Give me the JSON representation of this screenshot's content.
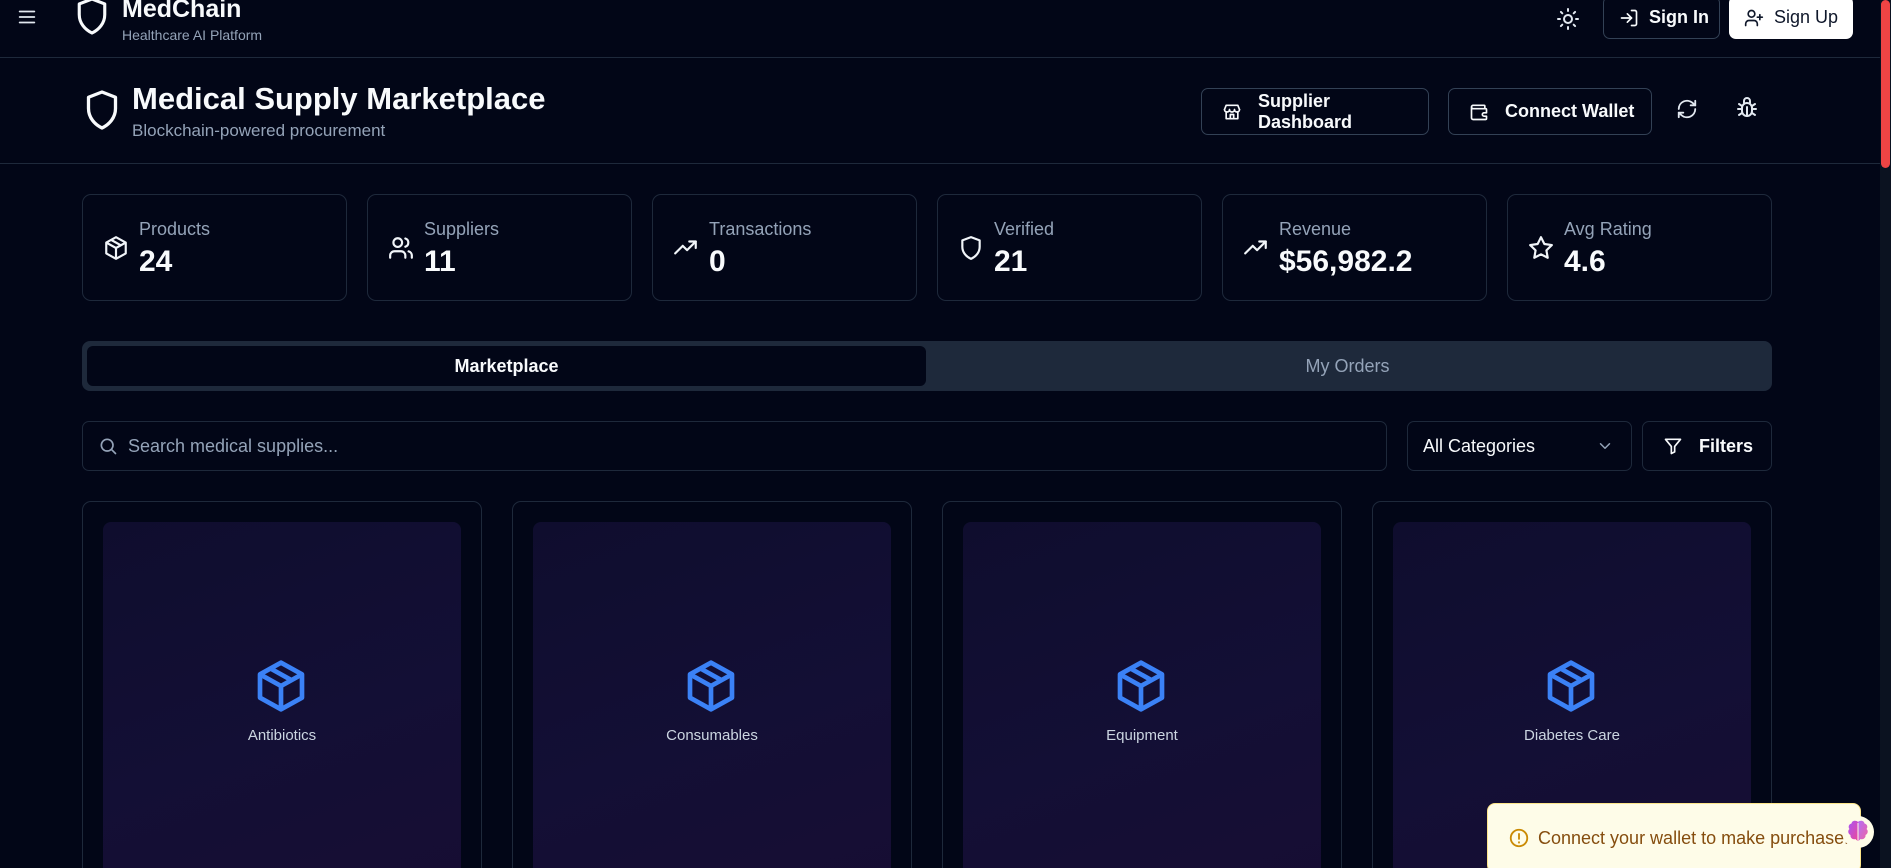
{
  "topbar": {
    "brand_name": "MedChain",
    "brand_subtitle": "Healthcare AI Platform",
    "signin_label": "Sign In",
    "signup_label": "Sign Up",
    "icons": [
      "menu-icon",
      "shield-icon",
      "sun-icon",
      "log-in-icon",
      "user-plus-icon"
    ]
  },
  "page": {
    "title": "Medical Supply Marketplace",
    "subtitle": "Blockchain-powered procurement",
    "supplier_dashboard_label": "Supplier Dashboard",
    "connect_wallet_label": "Connect Wallet",
    "icons": [
      "store-icon",
      "wallet-icon",
      "refresh-icon",
      "bug-icon"
    ]
  },
  "stats": [
    {
      "label": "Products",
      "value": "24",
      "icon": "package-icon"
    },
    {
      "label": "Suppliers",
      "value": "11",
      "icon": "users-icon"
    },
    {
      "label": "Transactions",
      "value": "0",
      "icon": "trending-up-icon"
    },
    {
      "label": "Verified",
      "value": "21",
      "icon": "shield-icon"
    },
    {
      "label": "Revenue",
      "value": "$56,982.2",
      "icon": "trending-up-icon"
    },
    {
      "label": "Avg Rating",
      "value": "4.6",
      "icon": "star-icon"
    }
  ],
  "tabs": [
    {
      "label": "Marketplace",
      "active": true
    },
    {
      "label": "My Orders",
      "active": false
    }
  ],
  "search": {
    "placeholder": "Search medical supplies..."
  },
  "category_select": {
    "value": "All Categories"
  },
  "filters_label": "Filters",
  "products": [
    {
      "category": "Antibiotics"
    },
    {
      "category": "Consumables"
    },
    {
      "category": "Equipment"
    },
    {
      "category": "Diabetes Care"
    }
  ],
  "toast": {
    "message": "Connect your wallet to make purchase."
  },
  "colors": {
    "background": "#020617",
    "border": "#1e293b",
    "accent_blue": "#3b82f6",
    "toast_bg": "#fefce8",
    "toast_text": "#854d0e",
    "scrollbar": "#ef4444"
  }
}
